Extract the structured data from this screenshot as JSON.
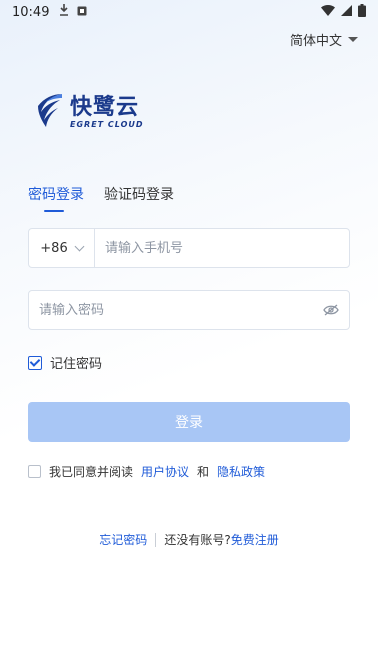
{
  "status_bar": {
    "time": "10:49"
  },
  "language": {
    "label": "简体中文"
  },
  "brand": {
    "name_cn": "快鹭云",
    "name_en": "EGRET CLOUD"
  },
  "tabs": [
    {
      "label": "密码登录",
      "active": true
    },
    {
      "label": "验证码登录",
      "active": false
    }
  ],
  "phone": {
    "country_code": "+86",
    "placeholder": "请输入手机号",
    "value": ""
  },
  "password": {
    "placeholder": "请输入密码",
    "value": ""
  },
  "remember": {
    "label": "记住密码",
    "checked": true
  },
  "login_button": {
    "label": "登录"
  },
  "agreement": {
    "prefix": "我已同意并阅读",
    "user_agreement": "用户协议",
    "and": "和",
    "privacy_policy": "隐私政策",
    "checked": false
  },
  "footer": {
    "forgot": "忘记密码",
    "no_account": "还没有账号?",
    "register": "免费注册"
  },
  "colors": {
    "accent": "#1f5bd8",
    "button_disabled": "#a8c6f5",
    "brand": "#1b3a8c"
  }
}
